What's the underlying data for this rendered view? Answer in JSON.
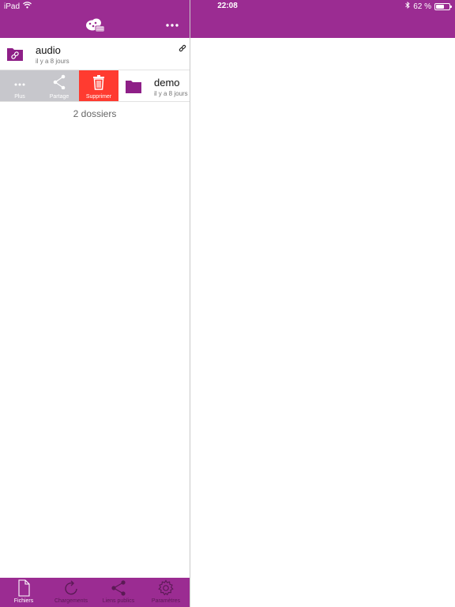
{
  "status": {
    "device": "iPad",
    "time": "22:08",
    "battery_text": "62 %",
    "battery_level": 0.62
  },
  "header": {
    "logo_icon": "cloud-logo-icon",
    "more_icon": "more-icon"
  },
  "list": {
    "items": [
      {
        "title": "audio",
        "subtitle": "il y a 8 jours",
        "icon": "shared-folder-icon",
        "badge_icon": "link-icon"
      },
      {
        "title": "demo",
        "subtitle": "il y a 8 jours",
        "icon": "folder-icon"
      }
    ],
    "swipe_actions": [
      {
        "label": "Plus",
        "icon": "more-icon"
      },
      {
        "label": "Partage",
        "icon": "share-icon"
      },
      {
        "label": "Supprimer",
        "icon": "trash-icon"
      }
    ],
    "footer": "2 dossiers"
  },
  "tabs": [
    {
      "label": "Fichiers",
      "icon": "file-icon",
      "active": true
    },
    {
      "label": "Chargements",
      "icon": "refresh-icon",
      "active": false
    },
    {
      "label": "Liens publics",
      "icon": "share-icon",
      "active": false
    },
    {
      "label": "Paramètres",
      "icon": "gear-icon",
      "active": false
    }
  ],
  "colors": {
    "brand": "#9b2c92",
    "delete": "#ff3b30",
    "action_gray": "#c7c7cc",
    "folder": "#8e1f87"
  }
}
